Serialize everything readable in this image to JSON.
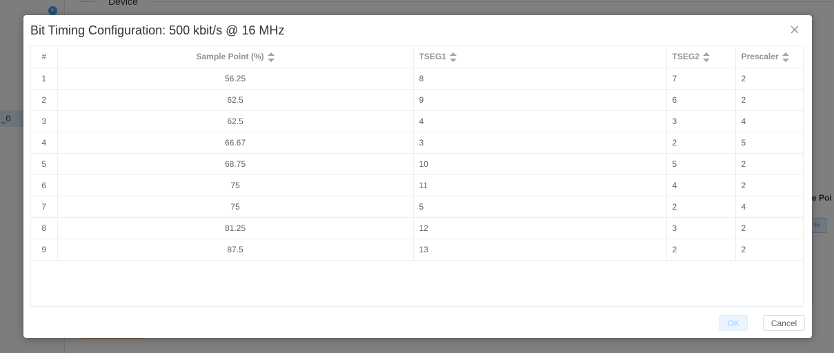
{
  "background": {
    "device_label": "Device",
    "selected_item": "_0",
    "right_header": "e Poi",
    "right_chip": "%"
  },
  "dialog": {
    "title": "Bit Timing Configuration: 500 kbit/s @ 16 MHz",
    "columns": [
      "#",
      "Sample Point (%)",
      "TSEG1",
      "TSEG2",
      "Prescaler"
    ],
    "rows": [
      [
        "1",
        "56.25",
        "8",
        "7",
        "2"
      ],
      [
        "2",
        "62.5",
        "9",
        "6",
        "2"
      ],
      [
        "3",
        "62.5",
        "4",
        "3",
        "4"
      ],
      [
        "4",
        "66.67",
        "3",
        "2",
        "5"
      ],
      [
        "5",
        "68.75",
        "10",
        "5",
        "2"
      ],
      [
        "6",
        "75",
        "11",
        "4",
        "2"
      ],
      [
        "7",
        "75",
        "5",
        "2",
        "4"
      ],
      [
        "8",
        "81.25",
        "12",
        "3",
        "2"
      ],
      [
        "9",
        "87.5",
        "13",
        "2",
        "2"
      ]
    ],
    "ok_label": "OK",
    "cancel_label": "Cancel"
  },
  "colors": {
    "accent": "#409eff",
    "header_text": "#909399",
    "cell_text": "#606266"
  },
  "icons": [
    "close-icon",
    "sort-icon",
    "add-icon"
  ]
}
